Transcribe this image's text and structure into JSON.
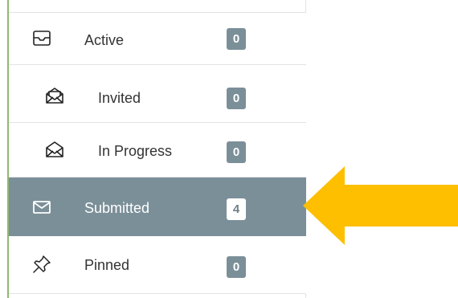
{
  "nav": {
    "items": [
      {
        "label": "Active",
        "count": "0",
        "icon": "inbox-tray-icon",
        "selected": false
      },
      {
        "label": "Invited",
        "count": "0",
        "icon": "envelope-open-letter-icon",
        "selected": false
      },
      {
        "label": "In Progress",
        "count": "0",
        "icon": "envelope-open-icon",
        "selected": false
      },
      {
        "label": "Submitted",
        "count": "4",
        "icon": "envelope-closed-icon",
        "selected": true
      },
      {
        "label": "Pinned",
        "count": "0",
        "icon": "pushpin-icon",
        "selected": false
      }
    ]
  },
  "colors": {
    "accent_line": "#8fb870",
    "selected_row": "#7b8f98",
    "badge": "#7b8f98",
    "callout_arrow": "#fdbf00"
  }
}
